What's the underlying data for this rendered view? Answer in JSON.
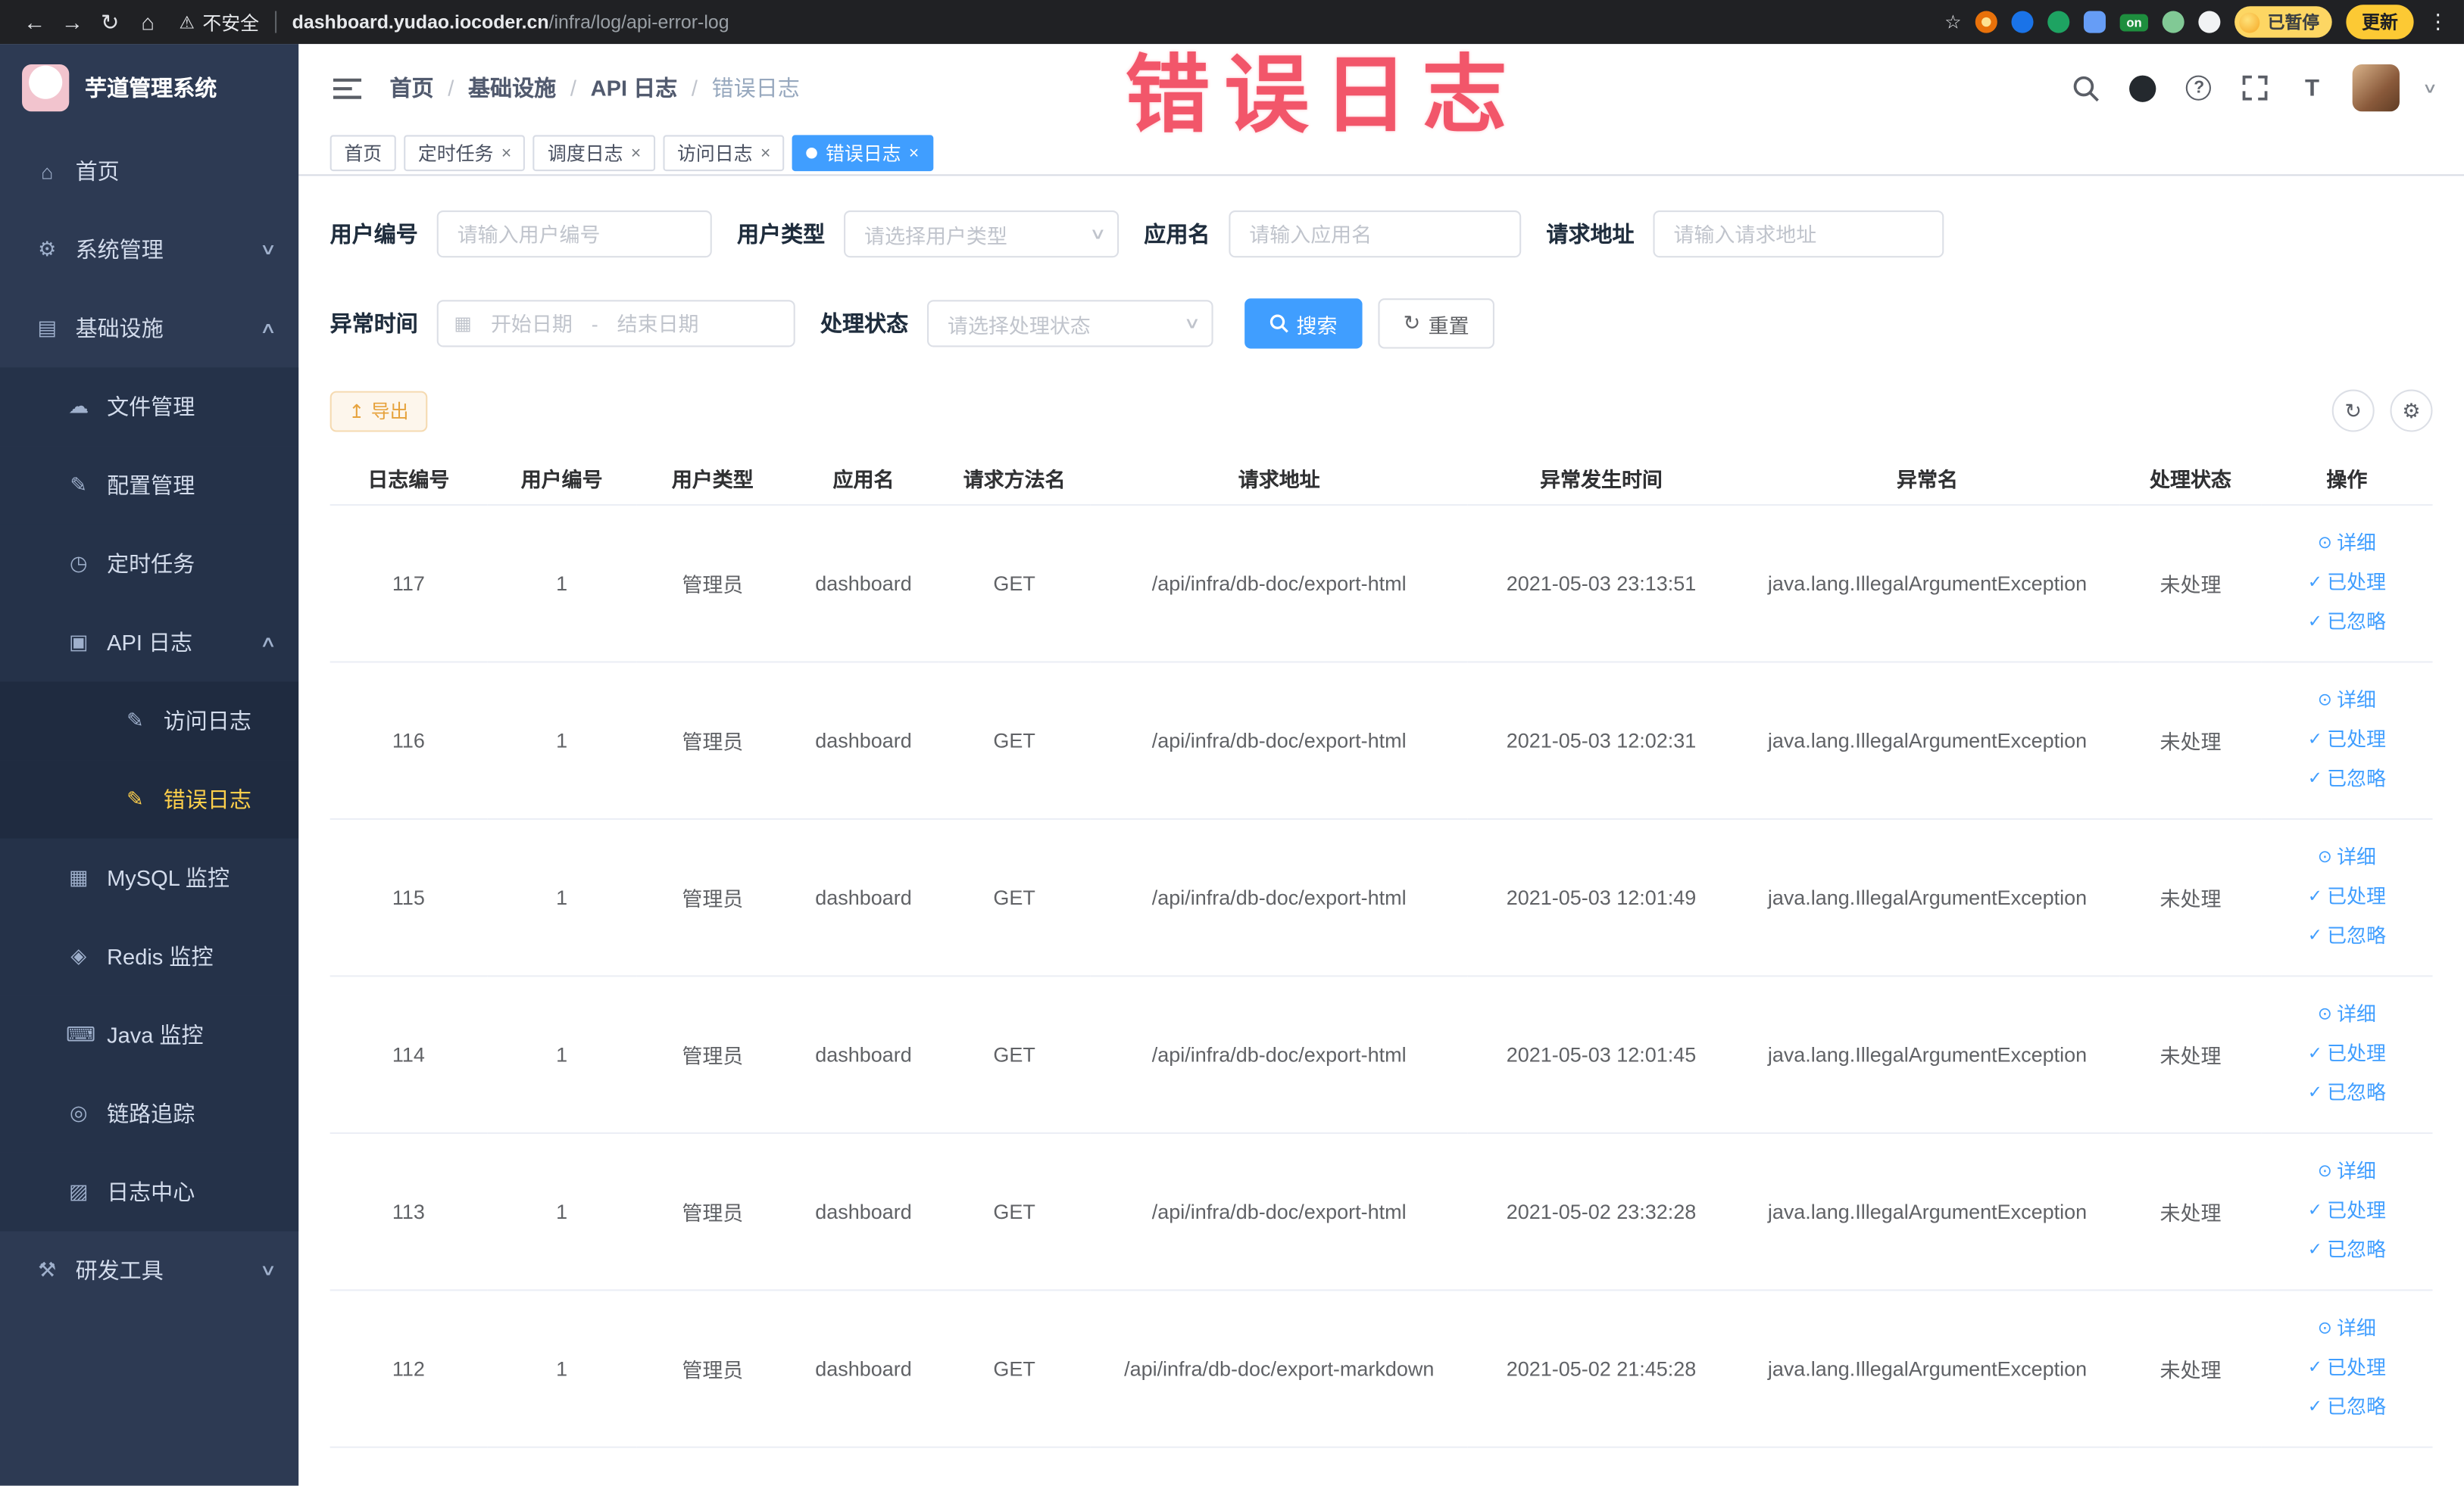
{
  "browser": {
    "security_label": "不安全",
    "url_domain": "dashboard.yudao.iocoder.cn",
    "url_path": "/infra/log/api-error-log",
    "on_badge": "on",
    "paused_badge": "已暂停",
    "update_button": "更新"
  },
  "watermark": "错误日志",
  "sidebar": {
    "logo_title": "芋道管理系统",
    "items": [
      {
        "label": "首页"
      },
      {
        "label": "系统管理"
      },
      {
        "label": "基础设施"
      },
      {
        "label": "文件管理"
      },
      {
        "label": "配置管理"
      },
      {
        "label": "定时任务"
      },
      {
        "label": "API 日志"
      },
      {
        "label": "访问日志"
      },
      {
        "label": "错误日志"
      },
      {
        "label": "MySQL 监控"
      },
      {
        "label": "Redis 监控"
      },
      {
        "label": "Java 监控"
      },
      {
        "label": "链路追踪"
      },
      {
        "label": "日志中心"
      },
      {
        "label": "研发工具"
      }
    ]
  },
  "header": {
    "breadcrumb": [
      "首页",
      "基础设施",
      "API 日志",
      "错误日志"
    ],
    "separator": "/"
  },
  "tabs": [
    "首页",
    "定时任务",
    "调度日志",
    "访问日志",
    "错误日志"
  ],
  "filters": {
    "user_id": {
      "label": "用户编号",
      "placeholder": "请输入用户编号"
    },
    "user_type": {
      "label": "用户类型",
      "placeholder": "请选择用户类型"
    },
    "app_name": {
      "label": "应用名",
      "placeholder": "请输入应用名"
    },
    "request_url": {
      "label": "请求地址",
      "placeholder": "请输入请求地址"
    },
    "exception_time": {
      "label": "异常时间",
      "start_placeholder": "开始日期",
      "separator": "-",
      "end_placeholder": "结束日期"
    },
    "process_status": {
      "label": "处理状态",
      "placeholder": "请选择处理状态"
    },
    "search_button": "搜索",
    "reset_button": "重置"
  },
  "toolbar": {
    "export_button": "导出"
  },
  "table": {
    "headers": [
      "日志编号",
      "用户编号",
      "用户类型",
      "应用名",
      "请求方法名",
      "请求地址",
      "异常发生时间",
      "异常名",
      "处理状态",
      "操作"
    ],
    "actions": {
      "detail": "详细",
      "processed": "已处理",
      "ignored": "已忽略"
    },
    "rows": [
      {
        "id": "117",
        "user_id": "1",
        "user_type": "管理员",
        "app": "dashboard",
        "method": "GET",
        "url": "/api/infra/db-doc/export-html",
        "time": "2021-05-03 23:13:51",
        "exception": "java.lang.IllegalArgumentException",
        "status": "未处理"
      },
      {
        "id": "116",
        "user_id": "1",
        "user_type": "管理员",
        "app": "dashboard",
        "method": "GET",
        "url": "/api/infra/db-doc/export-html",
        "time": "2021-05-03 12:02:31",
        "exception": "java.lang.IllegalArgumentException",
        "status": "未处理"
      },
      {
        "id": "115",
        "user_id": "1",
        "user_type": "管理员",
        "app": "dashboard",
        "method": "GET",
        "url": "/api/infra/db-doc/export-html",
        "time": "2021-05-03 12:01:49",
        "exception": "java.lang.IllegalArgumentException",
        "status": "未处理"
      },
      {
        "id": "114",
        "user_id": "1",
        "user_type": "管理员",
        "app": "dashboard",
        "method": "GET",
        "url": "/api/infra/db-doc/export-html",
        "time": "2021-05-03 12:01:45",
        "exception": "java.lang.IllegalArgumentException",
        "status": "未处理"
      },
      {
        "id": "113",
        "user_id": "1",
        "user_type": "管理员",
        "app": "dashboard",
        "method": "GET",
        "url": "/api/infra/db-doc/export-html",
        "time": "2021-05-02 23:32:28",
        "exception": "java.lang.IllegalArgumentException",
        "status": "未处理"
      },
      {
        "id": "112",
        "user_id": "1",
        "user_type": "管理员",
        "app": "dashboard",
        "method": "GET",
        "url": "/api/infra/db-doc/export-markdown",
        "time": "2021-05-02 21:45:28",
        "exception": "java.lang.IllegalArgumentException",
        "status": "未处理"
      }
    ]
  },
  "icons": {
    "back": "←",
    "forward": "→",
    "reload": "↻",
    "home": "⌂",
    "warning": "⚠",
    "star": "☆",
    "menu_dots": "⋮",
    "close": "×",
    "chevron_down": "∨",
    "chevron_up": "∧",
    "caret_down": "▾",
    "home_menu": "⌂",
    "system": "⚙",
    "infra": "▤",
    "file": "☁",
    "config": "✎",
    "cron": "◷",
    "api_log": "▣",
    "doc": "✎",
    "mysql": "▦",
    "redis": "◈",
    "java": "⌨",
    "trace": "◎",
    "log_center": "▨",
    "devtools": "⚒",
    "calendar": "▦",
    "refresh": "↻",
    "gear": "⚙",
    "export": "↥",
    "eye": "⊙",
    "check": "✓",
    "question": "?",
    "font_size": "T"
  }
}
